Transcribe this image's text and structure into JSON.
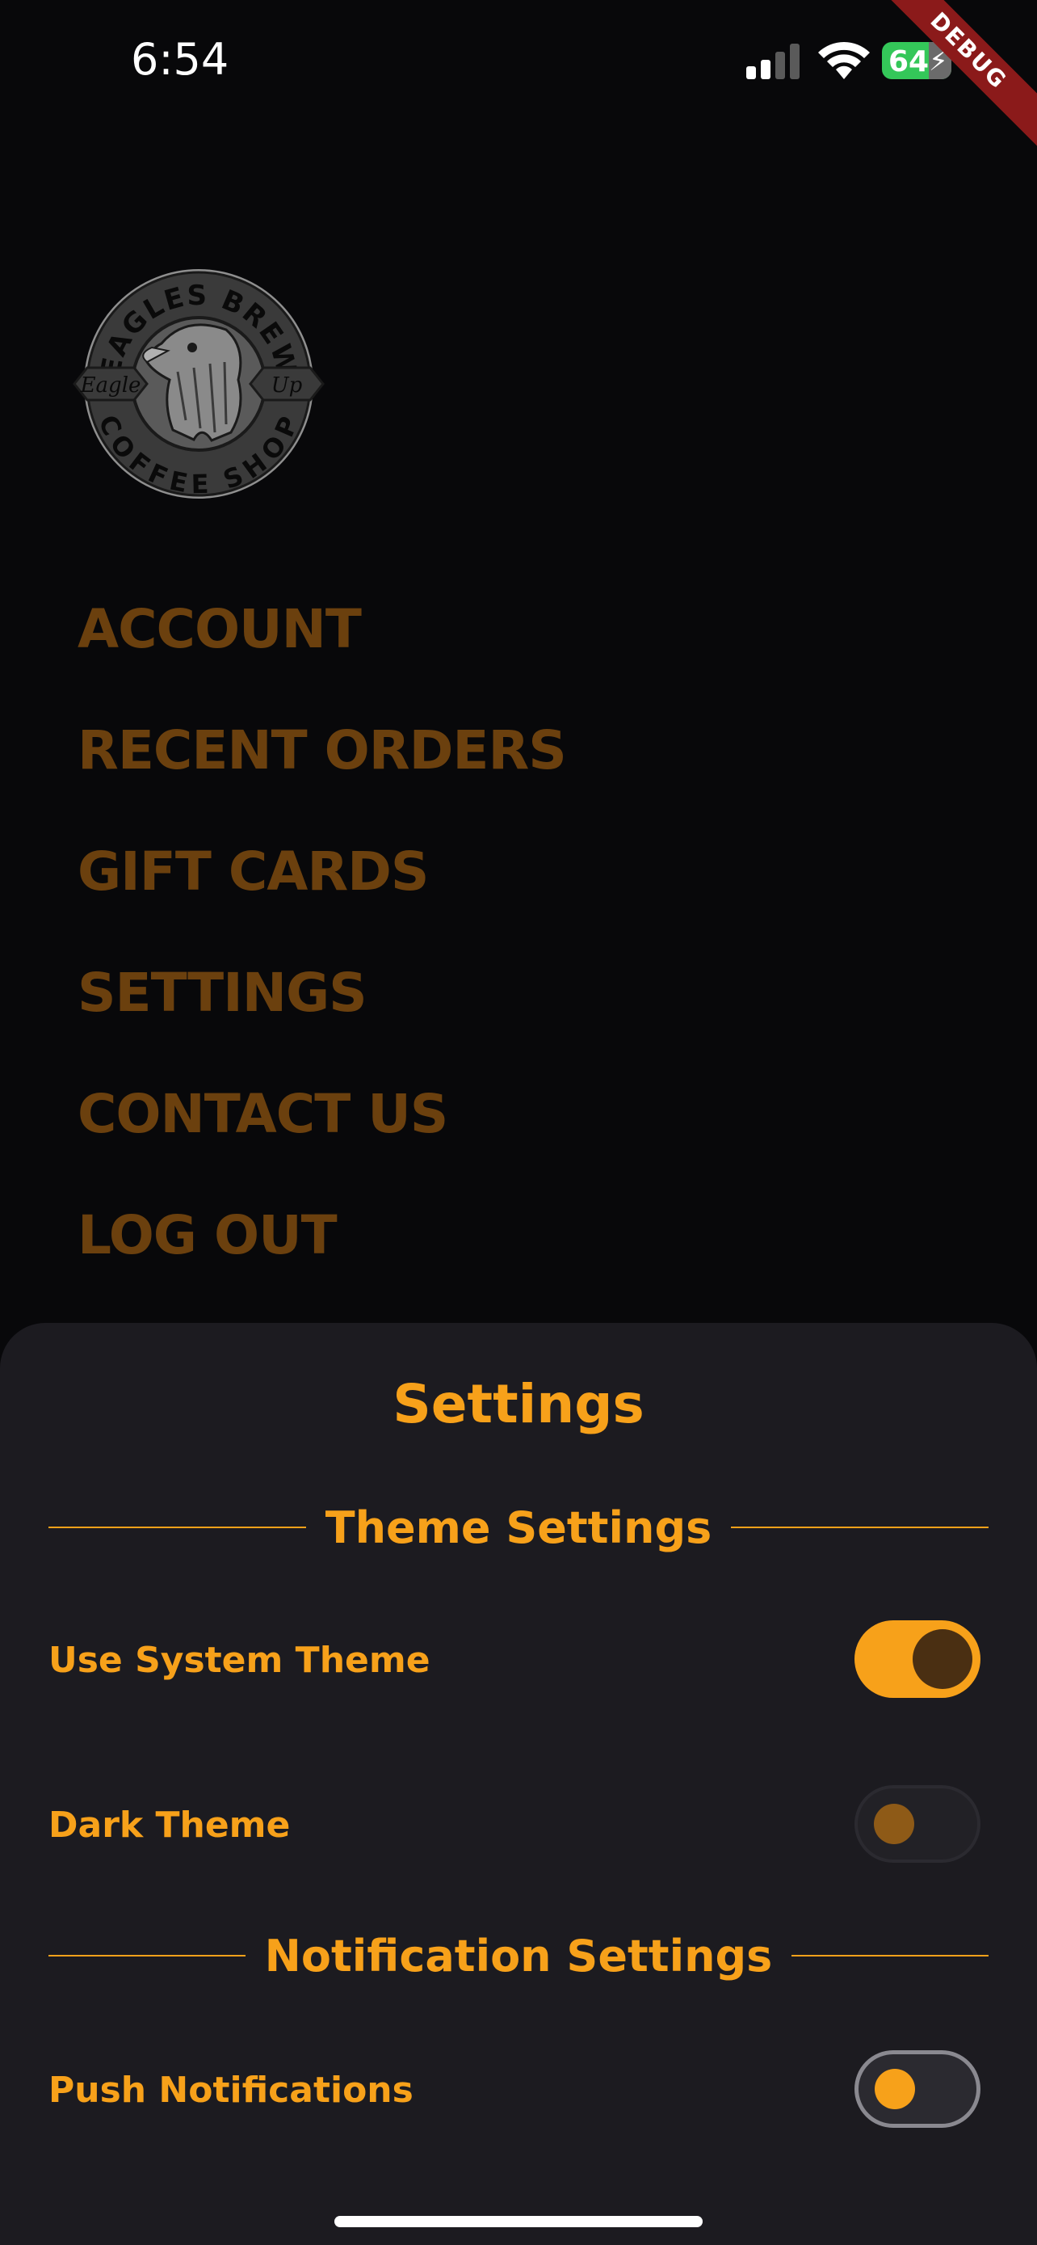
{
  "status_bar": {
    "time": "6:54",
    "battery": "64"
  },
  "debug_banner": "DEBUG",
  "logo": {
    "top_text": "EAGLES BREW",
    "bottom_text": "COFFEE SHOP",
    "left_text": "Eagle",
    "right_text": "Up"
  },
  "menu": {
    "items": [
      {
        "label": "ACCOUNT"
      },
      {
        "label": "RECENT ORDERS"
      },
      {
        "label": "GIFT CARDS"
      },
      {
        "label": "SETTINGS"
      },
      {
        "label": "CONTACT US"
      },
      {
        "label": "LOG OUT"
      }
    ]
  },
  "settings": {
    "title": "Settings",
    "theme_section": "Theme Settings",
    "use_system_theme": {
      "label": "Use System Theme",
      "enabled": true
    },
    "dark_theme": {
      "label": "Dark Theme",
      "enabled": false
    },
    "notification_section": "Notification Settings",
    "push_notifications": {
      "label": "Push Notifications",
      "enabled": false
    }
  },
  "colors": {
    "accent": "#f7a11a",
    "menu_text": "#6b400e",
    "sheet_bg": "#1c1b20",
    "page_bg": "#08080a"
  }
}
